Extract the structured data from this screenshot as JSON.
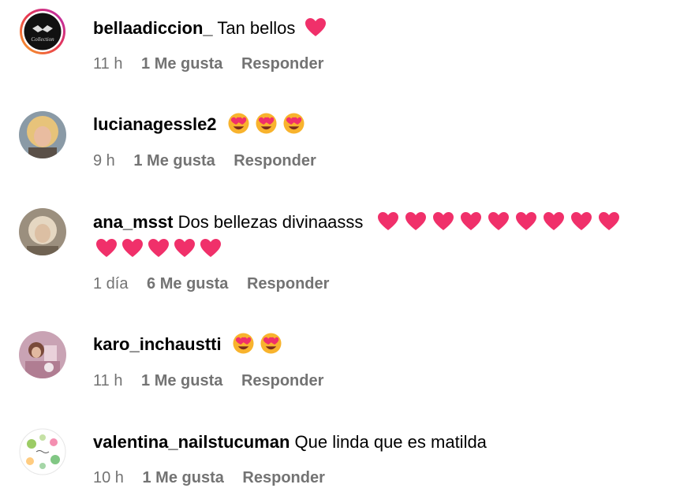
{
  "comments": [
    {
      "username": "bellaadiccion_",
      "text": "Tan bellos",
      "emojis": [
        "heart"
      ],
      "time": "11 h",
      "likes": "1 Me gusta",
      "reply": "Responder"
    },
    {
      "username": "lucianagessle2",
      "text": "",
      "emojis": [
        "heart-eyes",
        "heart-eyes",
        "heart-eyes"
      ],
      "time": "9 h",
      "likes": "1 Me gusta",
      "reply": "Responder"
    },
    {
      "username": "ana_msst",
      "text": "Dos bellezas divinaasss",
      "emojis": [
        "heart",
        "heart",
        "heart",
        "heart",
        "heart",
        "heart",
        "heart",
        "heart",
        "heart",
        "heart",
        "heart",
        "heart",
        "heart",
        "heart"
      ],
      "time": "1 día",
      "likes": "6 Me gusta",
      "reply": "Responder"
    },
    {
      "username": "karo_inchaustti",
      "text": "",
      "emojis": [
        "heart-eyes",
        "heart-eyes"
      ],
      "time": "11 h",
      "likes": "1 Me gusta",
      "reply": "Responder"
    },
    {
      "username": "valentina_nailstucuman",
      "text": "Que linda que es matilda",
      "emojis": [],
      "time": "10 h",
      "likes": "1 Me gusta",
      "reply": "Responder"
    }
  ],
  "colors": {
    "meta_gray": "#737373",
    "heart_pink": "#f0306a",
    "story_ring_start": "#f9a825",
    "story_ring_end": "#d6249f"
  }
}
